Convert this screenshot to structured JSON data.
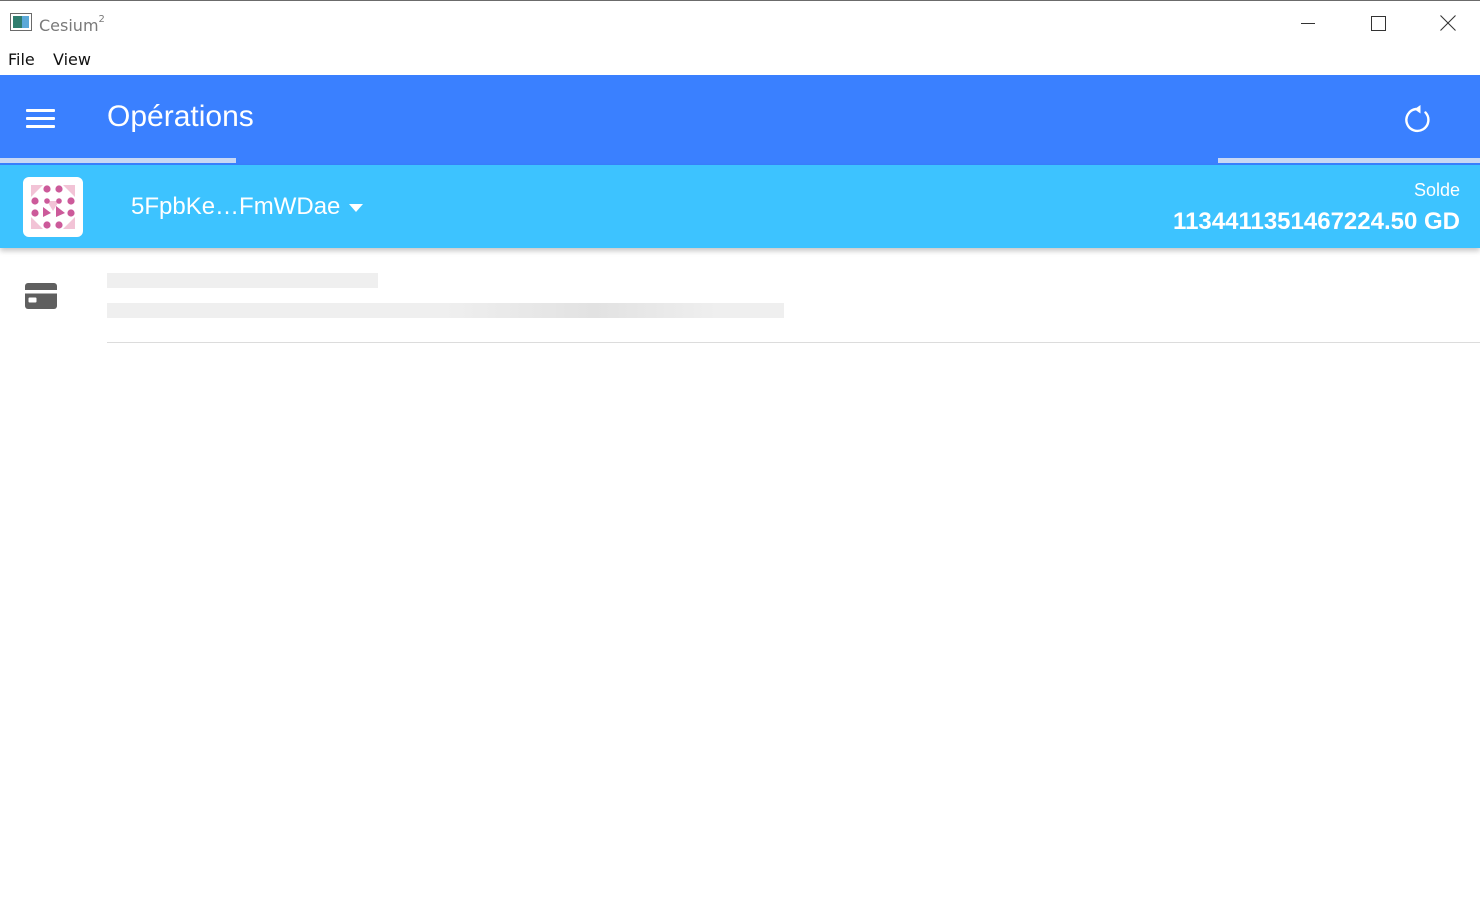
{
  "window": {
    "title": "Cesium",
    "title_superscript": "2",
    "controls": [
      "minimize",
      "maximize",
      "close"
    ]
  },
  "menu": {
    "file_label": "File",
    "view_label": "View"
  },
  "toolbar": {
    "title": "Opérations",
    "menu_icon": "hamburger-icon",
    "refresh_icon": "refresh-icon",
    "color": "#3a80ff"
  },
  "wallet": {
    "account": "5FpbKe…FmWDae",
    "balance_label": "Solde",
    "balance_value": "1134411351467224.50 GD",
    "color": "#3dc3ff",
    "avatar_icon": "identicon"
  },
  "content": {
    "row_icon": "card-icon",
    "loading": true
  }
}
